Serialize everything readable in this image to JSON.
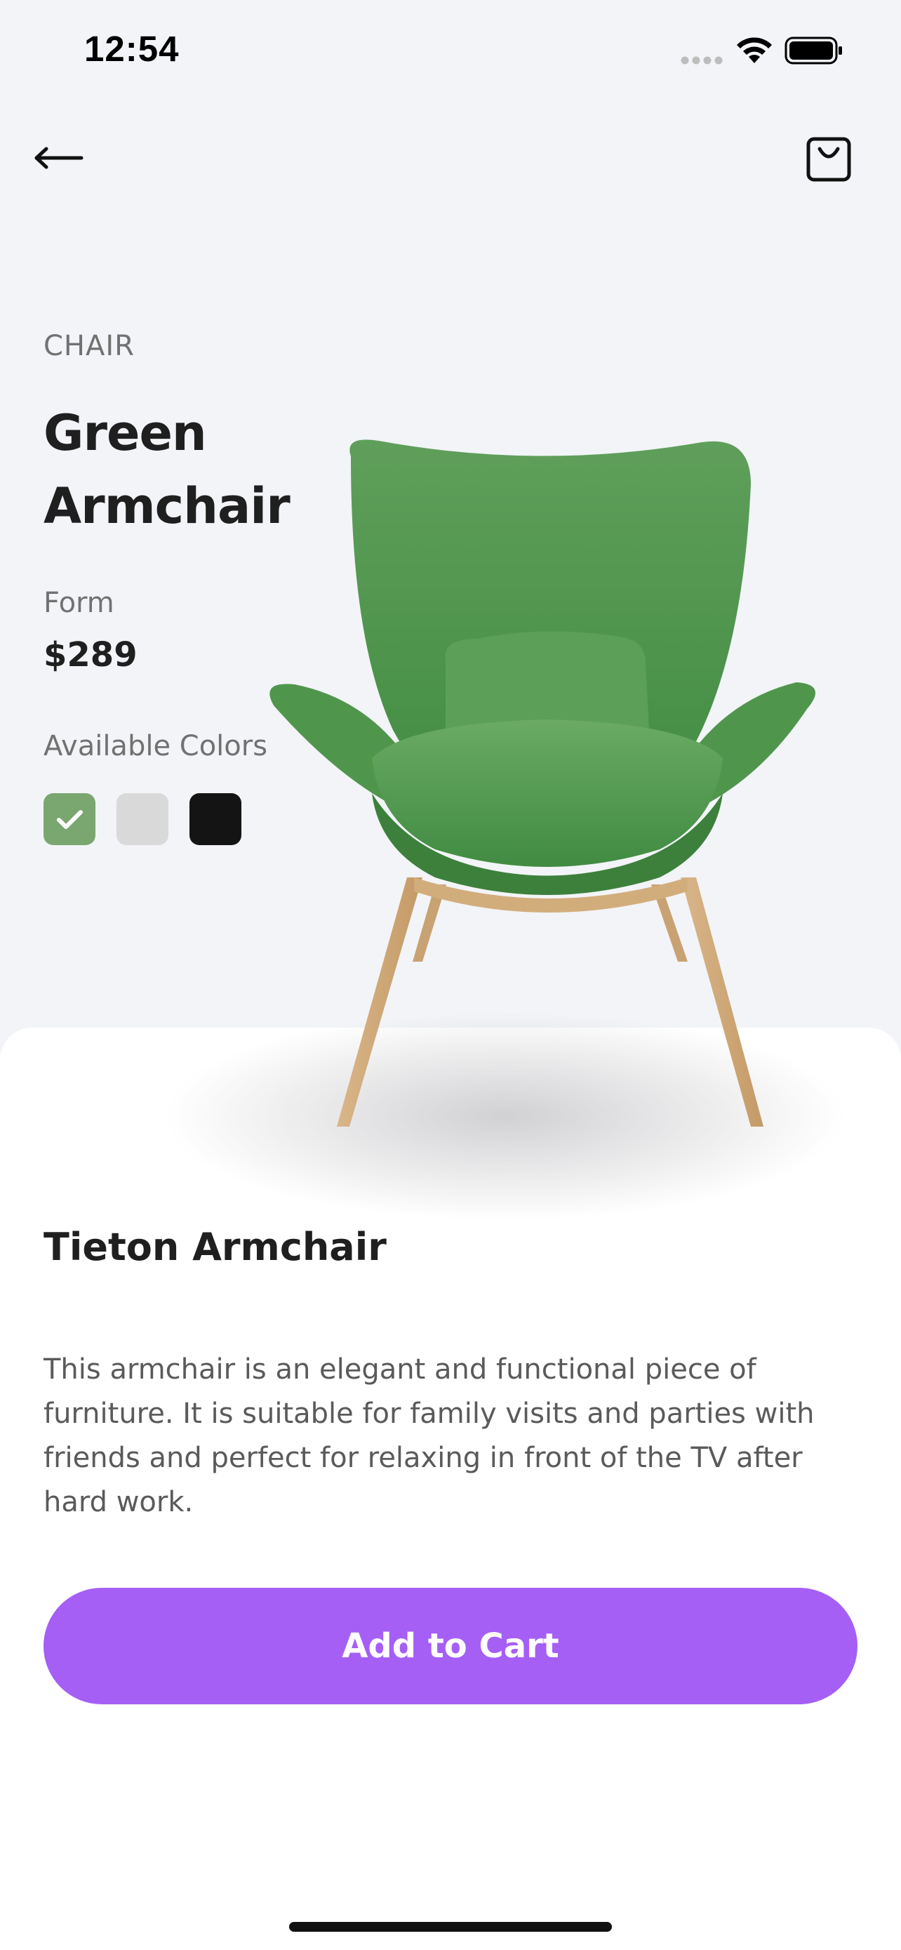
{
  "status_bar": {
    "time": "12:54"
  },
  "header": {
    "back_icon": "arrow-left-icon",
    "cart_icon": "shopping-bag-icon"
  },
  "product": {
    "category": "CHAIR",
    "name": "Green Armchair",
    "form_label": "Form",
    "price": "$289",
    "colors_label": "Available Colors",
    "colors": [
      {
        "hex": "#7aa670",
        "selected": true
      },
      {
        "hex": "#d9d9d9",
        "selected": false
      },
      {
        "hex": "#141414",
        "selected": false
      }
    ]
  },
  "details": {
    "title": "Tieton Armchair",
    "description": "This armchair is an elegant and functional piece of furniture. It is suitable for family visits and parties with friends and perfect for relaxing in front of the TV after hard work."
  },
  "cta": {
    "label": "Add to Cart",
    "color": "#a55ff5"
  }
}
